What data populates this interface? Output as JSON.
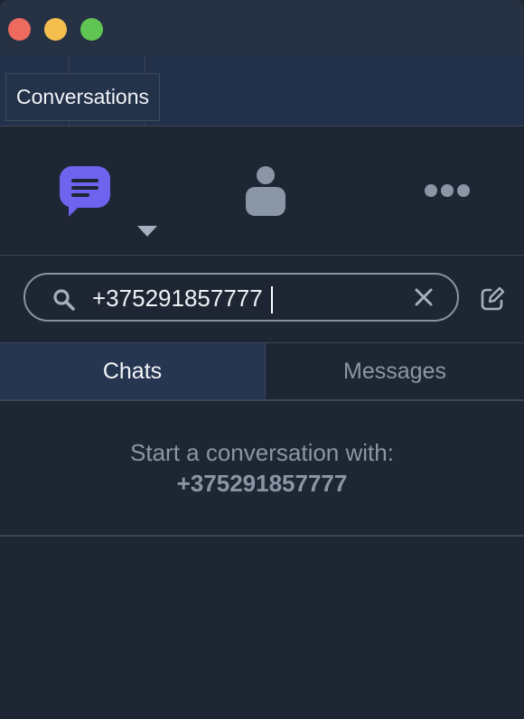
{
  "window": {
    "controls": [
      "close",
      "minimize",
      "zoom"
    ]
  },
  "toolbar": {
    "tooltip": "Conversations"
  },
  "nav": {
    "items": [
      {
        "icon": "chat-bubble-icon",
        "active": true
      },
      {
        "icon": "person-icon",
        "active": false
      },
      {
        "icon": "more-icon",
        "active": false
      }
    ],
    "accent_color": "#6e63ee"
  },
  "search": {
    "value": "+375291857777",
    "placeholder": ""
  },
  "tabs": {
    "chats": "Chats",
    "messages": "Messages"
  },
  "result": {
    "prompt": "Start a conversation with:",
    "number": "+375291857777"
  }
}
